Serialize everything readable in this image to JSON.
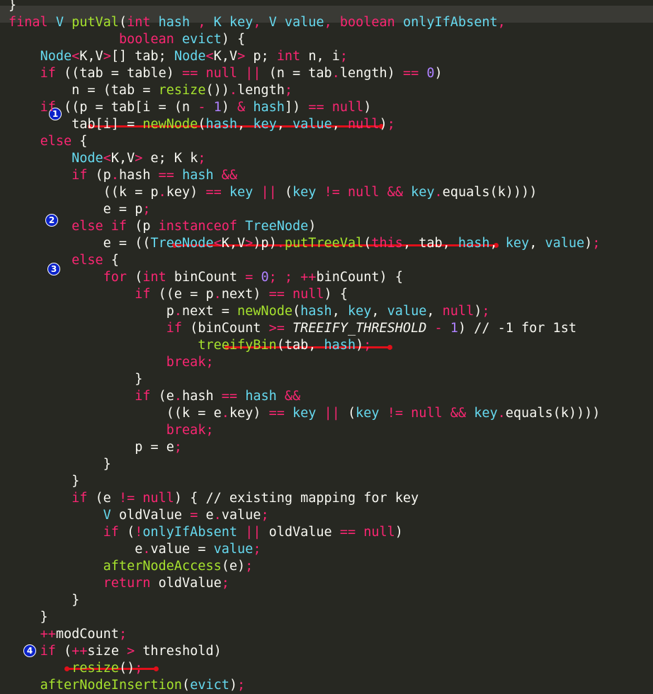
{
  "editor": {
    "theme": {
      "background": "#272822",
      "keyword": "#f92672",
      "type": "#66d9ef",
      "function": "#a6e22e",
      "number": "#ae81ff",
      "text": "#f8f8f2"
    },
    "markers": [
      "1",
      "2",
      "3",
      "4"
    ],
    "lines": [
      [
        [
          "",
          "}"
        ]
      ],
      [
        [
          "kw",
          "final "
        ],
        [
          "ty",
          "V "
        ],
        [
          "fn",
          "putVal"
        ],
        [
          "",
          "("
        ],
        [
          "kw",
          "int "
        ],
        [
          "ty",
          "hash"
        ],
        [
          "",
          " "
        ],
        [
          "kw",
          ", "
        ],
        [
          "ty",
          "K key"
        ],
        [
          "kw",
          ", "
        ],
        [
          "ty",
          "V value"
        ],
        [
          "kw",
          ", "
        ],
        [
          "kw",
          "boolean "
        ],
        [
          "ty",
          "onlyIfAbsent"
        ],
        [
          "kw",
          ","
        ]
      ],
      [
        [
          "",
          "              "
        ],
        [
          "kw",
          "boolean "
        ],
        [
          "ty",
          "evict"
        ],
        [
          "",
          ") {"
        ]
      ],
      [
        [
          "",
          "    "
        ],
        [
          "ty",
          "Node"
        ],
        [
          "kw",
          "<"
        ],
        [
          "",
          "K,V"
        ],
        [
          "kw",
          ">"
        ],
        [
          "",
          "[] tab; "
        ],
        [
          "ty",
          "Node"
        ],
        [
          "kw",
          "<"
        ],
        [
          "",
          "K,V"
        ],
        [
          "kw",
          "> "
        ],
        [
          "",
          "p; "
        ],
        [
          "kw",
          "int "
        ],
        [
          "",
          "n, i"
        ],
        [
          "kw",
          ";"
        ]
      ],
      [
        [
          "",
          "    "
        ],
        [
          "kw",
          "if "
        ],
        [
          "",
          "((tab = table) "
        ],
        [
          "kw",
          "== null || "
        ],
        [
          "",
          "(n = tab"
        ],
        [
          "kw",
          "."
        ],
        [
          "",
          "length) "
        ],
        [
          "kw",
          "== "
        ],
        [
          "num",
          "0"
        ],
        [
          "",
          ")"
        ]
      ],
      [
        [
          "",
          "        n = (tab = "
        ],
        [
          "fn",
          "resize"
        ],
        [
          "",
          "())"
        ],
        [
          "kw",
          "."
        ],
        [
          "",
          "length"
        ],
        [
          "kw",
          ";"
        ]
      ],
      [
        [
          "",
          "    "
        ],
        [
          "kw",
          "if "
        ],
        [
          "",
          "((p = tab[i = (n "
        ],
        [
          "kw",
          "- "
        ],
        [
          "num",
          "1"
        ],
        [
          "",
          ") "
        ],
        [
          "kw",
          "& "
        ],
        [
          "ty",
          "hash"
        ],
        [
          "",
          "]) "
        ],
        [
          "kw",
          "== null"
        ],
        [
          "",
          ")"
        ]
      ],
      [
        [
          "",
          "        tab[i] = "
        ],
        [
          "fn",
          "newNode"
        ],
        [
          "",
          "("
        ],
        [
          "ty",
          "hash"
        ],
        [
          "",
          ", "
        ],
        [
          "ty",
          "key"
        ],
        [
          "",
          ", "
        ],
        [
          "ty",
          "value"
        ],
        [
          "",
          ", "
        ],
        [
          "kw",
          "null"
        ],
        [
          "",
          ")"
        ],
        [
          "kw",
          ";"
        ]
      ],
      [
        [
          "",
          "    "
        ],
        [
          "kw",
          "else "
        ],
        [
          "",
          "{"
        ]
      ],
      [
        [
          "",
          "        "
        ],
        [
          "ty",
          "Node"
        ],
        [
          "kw",
          "<"
        ],
        [
          "",
          "K,V"
        ],
        [
          "kw",
          "> "
        ],
        [
          "",
          "e; K k"
        ],
        [
          "kw",
          ";"
        ]
      ],
      [
        [
          "",
          "        "
        ],
        [
          "kw",
          "if "
        ],
        [
          "",
          "(p"
        ],
        [
          "kw",
          "."
        ],
        [
          "",
          "hash "
        ],
        [
          "kw",
          "== "
        ],
        [
          "ty",
          "hash "
        ],
        [
          "kw",
          "&&"
        ]
      ],
      [
        [
          "",
          "            ((k = p"
        ],
        [
          "kw",
          "."
        ],
        [
          "",
          "key) "
        ],
        [
          "kw",
          "== "
        ],
        [
          "ty",
          "key "
        ],
        [
          "kw",
          "|| "
        ],
        [
          "",
          "("
        ],
        [
          "ty",
          "key "
        ],
        [
          "kw",
          "!= null && "
        ],
        [
          "ty",
          "key"
        ],
        [
          "kw",
          "."
        ],
        [
          "",
          "equals(k))))"
        ]
      ],
      [
        [
          "",
          "            e = p"
        ],
        [
          "kw",
          ";"
        ]
      ],
      [
        [
          "",
          "        "
        ],
        [
          "kw",
          "else if "
        ],
        [
          "",
          "(p "
        ],
        [
          "kw",
          "instanceof "
        ],
        [
          "ty",
          "TreeNode"
        ],
        [
          "",
          ")"
        ]
      ],
      [
        [
          "",
          "            e = (("
        ],
        [
          "ty",
          "TreeNode"
        ],
        [
          "kw",
          "<"
        ],
        [
          "",
          "K,V"
        ],
        [
          "kw",
          ">"
        ],
        [
          "",
          ")p)"
        ],
        [
          "kw",
          "."
        ],
        [
          "fn",
          "putTreeVal"
        ],
        [
          "",
          "("
        ],
        [
          "kw",
          "this"
        ],
        [
          "",
          ", tab, "
        ],
        [
          "ty",
          "hash"
        ],
        [
          "",
          ", "
        ],
        [
          "ty",
          "key"
        ],
        [
          "",
          ", "
        ],
        [
          "ty",
          "value"
        ],
        [
          "",
          ")"
        ],
        [
          "kw",
          ";"
        ]
      ],
      [
        [
          "",
          "        "
        ],
        [
          "kw",
          "else "
        ],
        [
          "",
          "{"
        ]
      ],
      [
        [
          "",
          "            "
        ],
        [
          "kw",
          "for "
        ],
        [
          "",
          "("
        ],
        [
          "kw",
          "int "
        ],
        [
          "",
          "binCount "
        ],
        [
          "kw",
          "= "
        ],
        [
          "num",
          "0"
        ],
        [
          "kw",
          "; ; "
        ],
        [
          "kw",
          "++"
        ],
        [
          "",
          "binCount) {"
        ]
      ],
      [
        [
          "",
          "                "
        ],
        [
          "kw",
          "if "
        ],
        [
          "",
          "((e = p"
        ],
        [
          "kw",
          "."
        ],
        [
          "",
          "next) "
        ],
        [
          "kw",
          "== null"
        ],
        [
          "",
          ") {"
        ]
      ],
      [
        [
          "",
          "                    p"
        ],
        [
          "kw",
          "."
        ],
        [
          "",
          "next = "
        ],
        [
          "fn",
          "newNode"
        ],
        [
          "",
          "("
        ],
        [
          "ty",
          "hash"
        ],
        [
          "",
          ", "
        ],
        [
          "ty",
          "key"
        ],
        [
          "",
          ", "
        ],
        [
          "ty",
          "value"
        ],
        [
          "",
          ", "
        ],
        [
          "kw",
          "null"
        ],
        [
          "",
          ")"
        ],
        [
          "kw",
          ";"
        ]
      ],
      [
        [
          "",
          "                    "
        ],
        [
          "kw",
          "if "
        ],
        [
          "",
          "(binCount "
        ],
        [
          "kw",
          ">= "
        ],
        [
          "ital",
          "TREEIFY_THRESHOLD "
        ],
        [
          "kw",
          "- "
        ],
        [
          "num",
          "1"
        ],
        [
          "",
          ") // -1 for 1st"
        ]
      ],
      [
        [
          "",
          "                        "
        ],
        [
          "fn",
          "treeifyBin"
        ],
        [
          "",
          "(tab, "
        ],
        [
          "ty",
          "hash"
        ],
        [
          "",
          ")"
        ],
        [
          "kw",
          ";"
        ]
      ],
      [
        [
          "",
          "                    "
        ],
        [
          "kw",
          "break;"
        ]
      ],
      [
        [
          "",
          "                }"
        ]
      ],
      [
        [
          "",
          "                "
        ],
        [
          "kw",
          "if "
        ],
        [
          "",
          "(e"
        ],
        [
          "kw",
          "."
        ],
        [
          "",
          "hash "
        ],
        [
          "kw",
          "== "
        ],
        [
          "ty",
          "hash "
        ],
        [
          "kw",
          "&&"
        ]
      ],
      [
        [
          "",
          "                    ((k = e"
        ],
        [
          "kw",
          "."
        ],
        [
          "",
          "key) "
        ],
        [
          "kw",
          "== "
        ],
        [
          "ty",
          "key "
        ],
        [
          "kw",
          "|| "
        ],
        [
          "",
          "("
        ],
        [
          "ty",
          "key "
        ],
        [
          "kw",
          "!= null && "
        ],
        [
          "ty",
          "key"
        ],
        [
          "kw",
          "."
        ],
        [
          "",
          "equals(k))))"
        ]
      ],
      [
        [
          "",
          "                    "
        ],
        [
          "kw",
          "break;"
        ]
      ],
      [
        [
          "",
          "                p = e"
        ],
        [
          "kw",
          ";"
        ]
      ],
      [
        [
          "",
          "            }"
        ]
      ],
      [
        [
          "",
          "        }"
        ]
      ],
      [
        [
          "",
          "        "
        ],
        [
          "kw",
          "if "
        ],
        [
          "",
          "(e "
        ],
        [
          "kw",
          "!= null"
        ],
        [
          "",
          ") { // existing mapping for key"
        ]
      ],
      [
        [
          "",
          "            "
        ],
        [
          "ty",
          "V "
        ],
        [
          "",
          "oldValue "
        ],
        [
          "kw",
          "= "
        ],
        [
          "",
          "e"
        ],
        [
          "kw",
          "."
        ],
        [
          "",
          "value"
        ],
        [
          "kw",
          ";"
        ]
      ],
      [
        [
          "",
          "            "
        ],
        [
          "kw",
          "if "
        ],
        [
          "",
          "("
        ],
        [
          "kw",
          "!"
        ],
        [
          "ty",
          "onlyIfAbsent "
        ],
        [
          "kw",
          "|| "
        ],
        [
          "",
          "oldValue "
        ],
        [
          "kw",
          "== null"
        ],
        [
          "",
          ")"
        ]
      ],
      [
        [
          "",
          "                e"
        ],
        [
          "kw",
          "."
        ],
        [
          "",
          "value = "
        ],
        [
          "ty",
          "value"
        ],
        [
          "kw",
          ";"
        ]
      ],
      [
        [
          "",
          "            "
        ],
        [
          "fn",
          "afterNodeAccess"
        ],
        [
          "",
          "(e)"
        ],
        [
          "kw",
          ";"
        ]
      ],
      [
        [
          "",
          "            "
        ],
        [
          "kw",
          "return "
        ],
        [
          "",
          "oldValue"
        ],
        [
          "kw",
          ";"
        ]
      ],
      [
        [
          "",
          "        }"
        ]
      ],
      [
        [
          "",
          "    }"
        ]
      ],
      [
        [
          "",
          "    "
        ],
        [
          "kw",
          "++"
        ],
        [
          "",
          "modCount"
        ],
        [
          "kw",
          ";"
        ]
      ],
      [
        [
          "",
          "    "
        ],
        [
          "kw",
          "if "
        ],
        [
          "",
          "("
        ],
        [
          "kw",
          "++"
        ],
        [
          "",
          "size "
        ],
        [
          "kw",
          "> "
        ],
        [
          "",
          "threshold)"
        ]
      ],
      [
        [
          "",
          "        "
        ],
        [
          "fn",
          "resize"
        ],
        [
          "",
          "()"
        ],
        [
          "kw",
          ";"
        ]
      ],
      [
        [
          "",
          "    "
        ],
        [
          "fn",
          "afterNodeInsertion"
        ],
        [
          "",
          "("
        ],
        [
          "ty",
          "evict"
        ],
        [
          "",
          ")"
        ],
        [
          "kw",
          ";"
        ]
      ]
    ]
  }
}
